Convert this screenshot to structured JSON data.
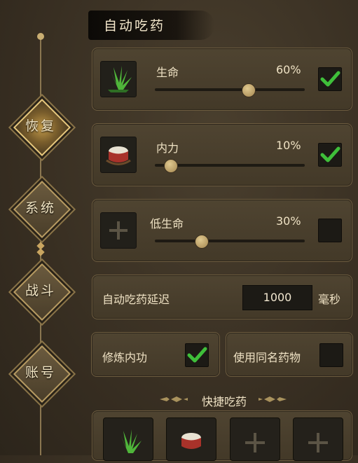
{
  "nav": {
    "items": [
      {
        "label": "恢复",
        "active": true
      },
      {
        "label": "系统",
        "active": false
      },
      {
        "label": "战斗",
        "active": false
      },
      {
        "label": "账号",
        "active": false
      }
    ]
  },
  "header": {
    "title": "自动吃药"
  },
  "sliders": [
    {
      "label": "生命",
      "percent_text": "60%",
      "value": 0.6,
      "checked": true,
      "icon": "herb-icon"
    },
    {
      "label": "内力",
      "percent_text": "10%",
      "value": 0.1,
      "checked": true,
      "icon": "drum-icon"
    },
    {
      "label": "低生命",
      "percent_text": "30%",
      "value": 0.3,
      "checked": false,
      "icon": "plus-icon"
    }
  ],
  "delay": {
    "label": "自动吃药延迟",
    "value": "1000",
    "unit": "毫秒"
  },
  "options": [
    {
      "label": "修炼内功",
      "checked": true
    },
    {
      "label": "使用同名药物",
      "checked": false
    }
  ],
  "quick": {
    "title": "快捷吃药",
    "slots": [
      "herb-icon",
      "drum-icon",
      "plus-icon",
      "plus-icon"
    ]
  },
  "colors": {
    "accent": "#c9ae72",
    "check": "#3fbf3a",
    "panel": "#4a3f2e"
  }
}
